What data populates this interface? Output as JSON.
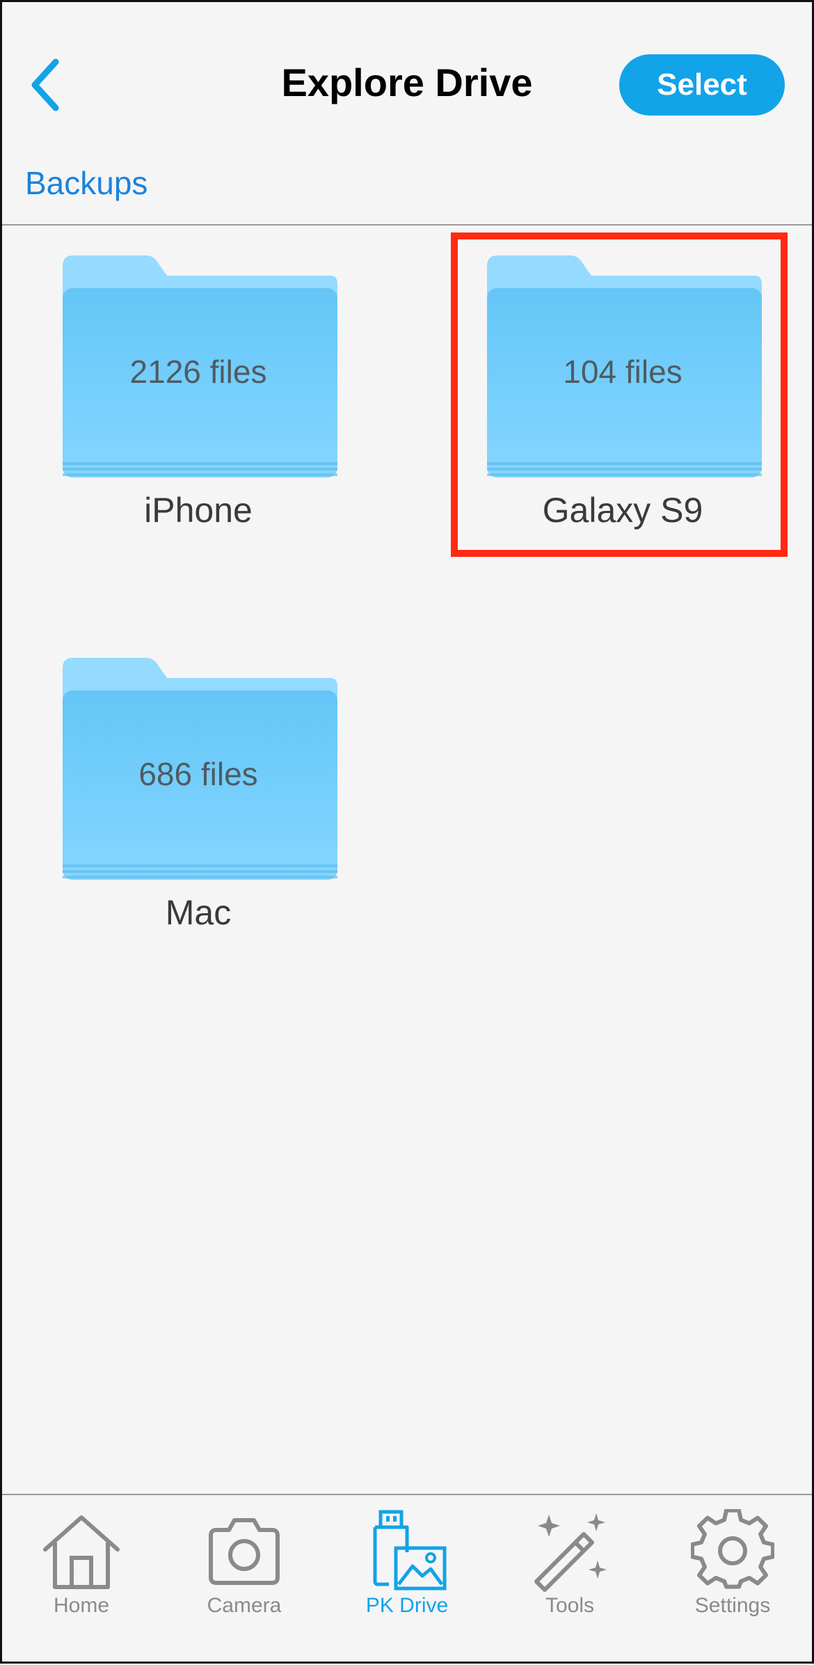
{
  "header": {
    "title": "Explore Drive",
    "select_label": "Select"
  },
  "breadcrumb": {
    "label": "Backups"
  },
  "folders": [
    {
      "name": "iPhone",
      "count": "2126 files"
    },
    {
      "name": "Galaxy S9",
      "count": "104 files"
    },
    {
      "name": "Mac",
      "count": "686 files"
    }
  ],
  "tabs": [
    {
      "label": "Home",
      "icon": "home-icon"
    },
    {
      "label": "Camera",
      "icon": "camera-icon"
    },
    {
      "label": "PK Drive",
      "icon": "pk-drive-icon"
    },
    {
      "label": "Tools",
      "icon": "magic-wand-icon"
    },
    {
      "label": "Settings",
      "icon": "gear-icon"
    }
  ],
  "colors": {
    "accent": "#12a3e8",
    "link": "#1a83dc",
    "highlight": "#ff2a12",
    "folder_front": "#6dcbf8",
    "folder_back": "#95daff"
  }
}
